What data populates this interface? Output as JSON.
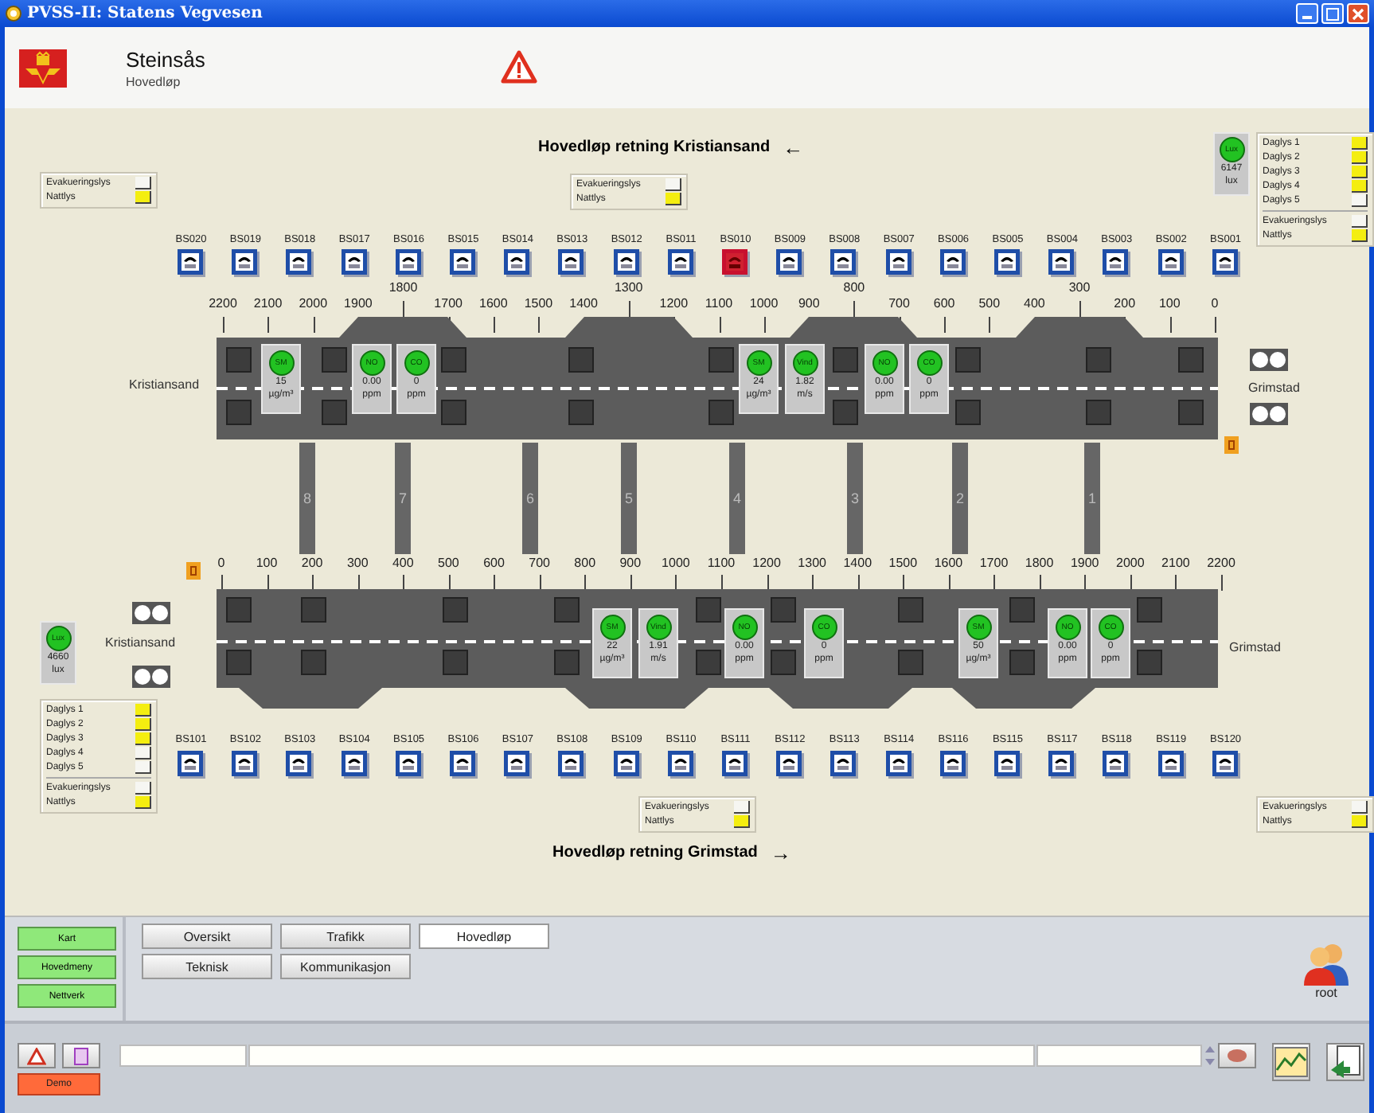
{
  "window": {
    "title": "PVSS-II: Statens Vegvesen"
  },
  "header": {
    "title": "Steinsås",
    "subtitle": "Hovedløp"
  },
  "upper": {
    "heading": "Hovedløp retning Kristiansand",
    "arrow": "←",
    "left_portal": "Kristiansand",
    "right_portal": "Grimstad",
    "left_panel": [
      {
        "label": "Evakueringslys",
        "on": false
      },
      {
        "label": "Nattlys",
        "on": true
      }
    ],
    "mid_panel": [
      {
        "label": "Evakueringslys",
        "on": false
      },
      {
        "label": "Nattlys",
        "on": true
      }
    ],
    "lux": {
      "name": "Lux",
      "value": "6147",
      "unit": "lux"
    },
    "daylight": [
      {
        "label": "Daglys 1",
        "on": true
      },
      {
        "label": "Daglys 2",
        "on": true
      },
      {
        "label": "Daglys 3",
        "on": true
      },
      {
        "label": "Daglys 4",
        "on": true
      },
      {
        "label": "Daglys 5",
        "on": false
      }
    ],
    "other_lights": [
      {
        "label": "Evakueringslys",
        "on": false
      },
      {
        "label": "Nattlys",
        "on": true
      }
    ],
    "stations": [
      {
        "label": "BS020",
        "alarm": false
      },
      {
        "label": "BS019",
        "alarm": false
      },
      {
        "label": "BS018",
        "alarm": false
      },
      {
        "label": "BS017",
        "alarm": false
      },
      {
        "label": "BS016",
        "alarm": false
      },
      {
        "label": "BS015",
        "alarm": false
      },
      {
        "label": "BS014",
        "alarm": false
      },
      {
        "label": "BS013",
        "alarm": false
      },
      {
        "label": "BS012",
        "alarm": false
      },
      {
        "label": "BS011",
        "alarm": false
      },
      {
        "label": "BS010",
        "alarm": true
      },
      {
        "label": "BS009",
        "alarm": false
      },
      {
        "label": "BS008",
        "alarm": false
      },
      {
        "label": "BS007",
        "alarm": false
      },
      {
        "label": "BS006",
        "alarm": false
      },
      {
        "label": "BS005",
        "alarm": false
      },
      {
        "label": "BS004",
        "alarm": false
      },
      {
        "label": "BS003",
        "alarm": false
      },
      {
        "label": "BS002",
        "alarm": false
      },
      {
        "label": "BS001",
        "alarm": false
      }
    ],
    "scale": [
      "2200",
      "2100",
      "2000",
      "1900",
      "1800",
      "1700",
      "1600",
      "1500",
      "1400",
      "1300",
      "1200",
      "1100",
      "1000",
      "900",
      "800",
      "700",
      "600",
      "500",
      "400",
      "300",
      "200",
      "100",
      "0"
    ],
    "sensors": [
      {
        "name": "SM",
        "value": "15",
        "unit": "µg/m³"
      },
      {
        "name": "NO",
        "value": "0.00",
        "unit": "ppm"
      },
      {
        "name": "CO",
        "value": "0",
        "unit": "ppm"
      },
      {
        "name": "SM",
        "value": "24",
        "unit": "µg/m³"
      },
      {
        "name": "Vind",
        "value": "1.82",
        "unit": "m/s"
      },
      {
        "name": "NO",
        "value": "0.00",
        "unit": "ppm"
      },
      {
        "name": "CO",
        "value": "0",
        "unit": "ppm"
      }
    ]
  },
  "cross_passages": [
    "8",
    "7",
    "6",
    "5",
    "4",
    "3",
    "2",
    "1"
  ],
  "lower": {
    "heading": "Hovedløp retning Grimstad",
    "arrow": "→",
    "left_portal": "Kristiansand",
    "right_portal": "Grimstad",
    "lux": {
      "name": "Lux",
      "value": "4660",
      "unit": "lux"
    },
    "daylight": [
      {
        "label": "Daglys 1",
        "on": true
      },
      {
        "label": "Daglys 2",
        "on": true
      },
      {
        "label": "Daglys 3",
        "on": true
      },
      {
        "label": "Daglys 4",
        "on": false
      },
      {
        "label": "Daglys 5",
        "on": false
      }
    ],
    "other_lights": [
      {
        "label": "Evakueringslys",
        "on": false
      },
      {
        "label": "Nattlys",
        "on": true
      }
    ],
    "mid_panel": [
      {
        "label": "Evakueringslys",
        "on": false
      },
      {
        "label": "Nattlys",
        "on": true
      }
    ],
    "right_panel": [
      {
        "label": "Evakueringslys",
        "on": false
      },
      {
        "label": "Nattlys",
        "on": true
      }
    ],
    "stations": [
      {
        "label": "BS101",
        "alarm": false
      },
      {
        "label": "BS102",
        "alarm": false
      },
      {
        "label": "BS103",
        "alarm": false
      },
      {
        "label": "BS104",
        "alarm": false
      },
      {
        "label": "BS105",
        "alarm": false
      },
      {
        "label": "BS106",
        "alarm": false
      },
      {
        "label": "BS107",
        "alarm": false
      },
      {
        "label": "BS108",
        "alarm": false
      },
      {
        "label": "BS109",
        "alarm": false
      },
      {
        "label": "BS110",
        "alarm": false
      },
      {
        "label": "BS111",
        "alarm": false
      },
      {
        "label": "BS112",
        "alarm": false
      },
      {
        "label": "BS113",
        "alarm": false
      },
      {
        "label": "BS114",
        "alarm": false
      },
      {
        "label": "BS116",
        "alarm": false
      },
      {
        "label": "BS115",
        "alarm": false
      },
      {
        "label": "BS117",
        "alarm": false
      },
      {
        "label": "BS118",
        "alarm": false
      },
      {
        "label": "BS119",
        "alarm": false
      },
      {
        "label": "BS120",
        "alarm": false
      }
    ],
    "scale": [
      "0",
      "100",
      "200",
      "300",
      "400",
      "500",
      "600",
      "700",
      "800",
      "900",
      "1000",
      "1100",
      "1200",
      "1300",
      "1400",
      "1500",
      "1600",
      "1700",
      "1800",
      "1900",
      "2000",
      "2100",
      "2200"
    ],
    "sensors": [
      {
        "name": "SM",
        "value": "22",
        "unit": "µg/m³"
      },
      {
        "name": "Vind",
        "value": "1.91",
        "unit": "m/s"
      },
      {
        "name": "NO",
        "value": "0.00",
        "unit": "ppm"
      },
      {
        "name": "CO",
        "value": "0",
        "unit": "ppm"
      },
      {
        "name": "SM",
        "value": "50",
        "unit": "µg/m³"
      },
      {
        "name": "NO",
        "value": "0.00",
        "unit": "ppm"
      },
      {
        "name": "CO",
        "value": "0",
        "unit": "ppm"
      }
    ]
  },
  "side_buttons": [
    "Kart",
    "Hovedmeny",
    "Nettverk"
  ],
  "tabs": [
    {
      "label": "Oversikt",
      "selected": false
    },
    {
      "label": "Trafikk",
      "selected": false
    },
    {
      "label": "Hovedløp",
      "selected": true
    },
    {
      "label": "Teknisk",
      "selected": false
    },
    {
      "label": "Kommunikasjon",
      "selected": false
    }
  ],
  "user": "root",
  "status_bar": {
    "mode_button": "Demo"
  }
}
